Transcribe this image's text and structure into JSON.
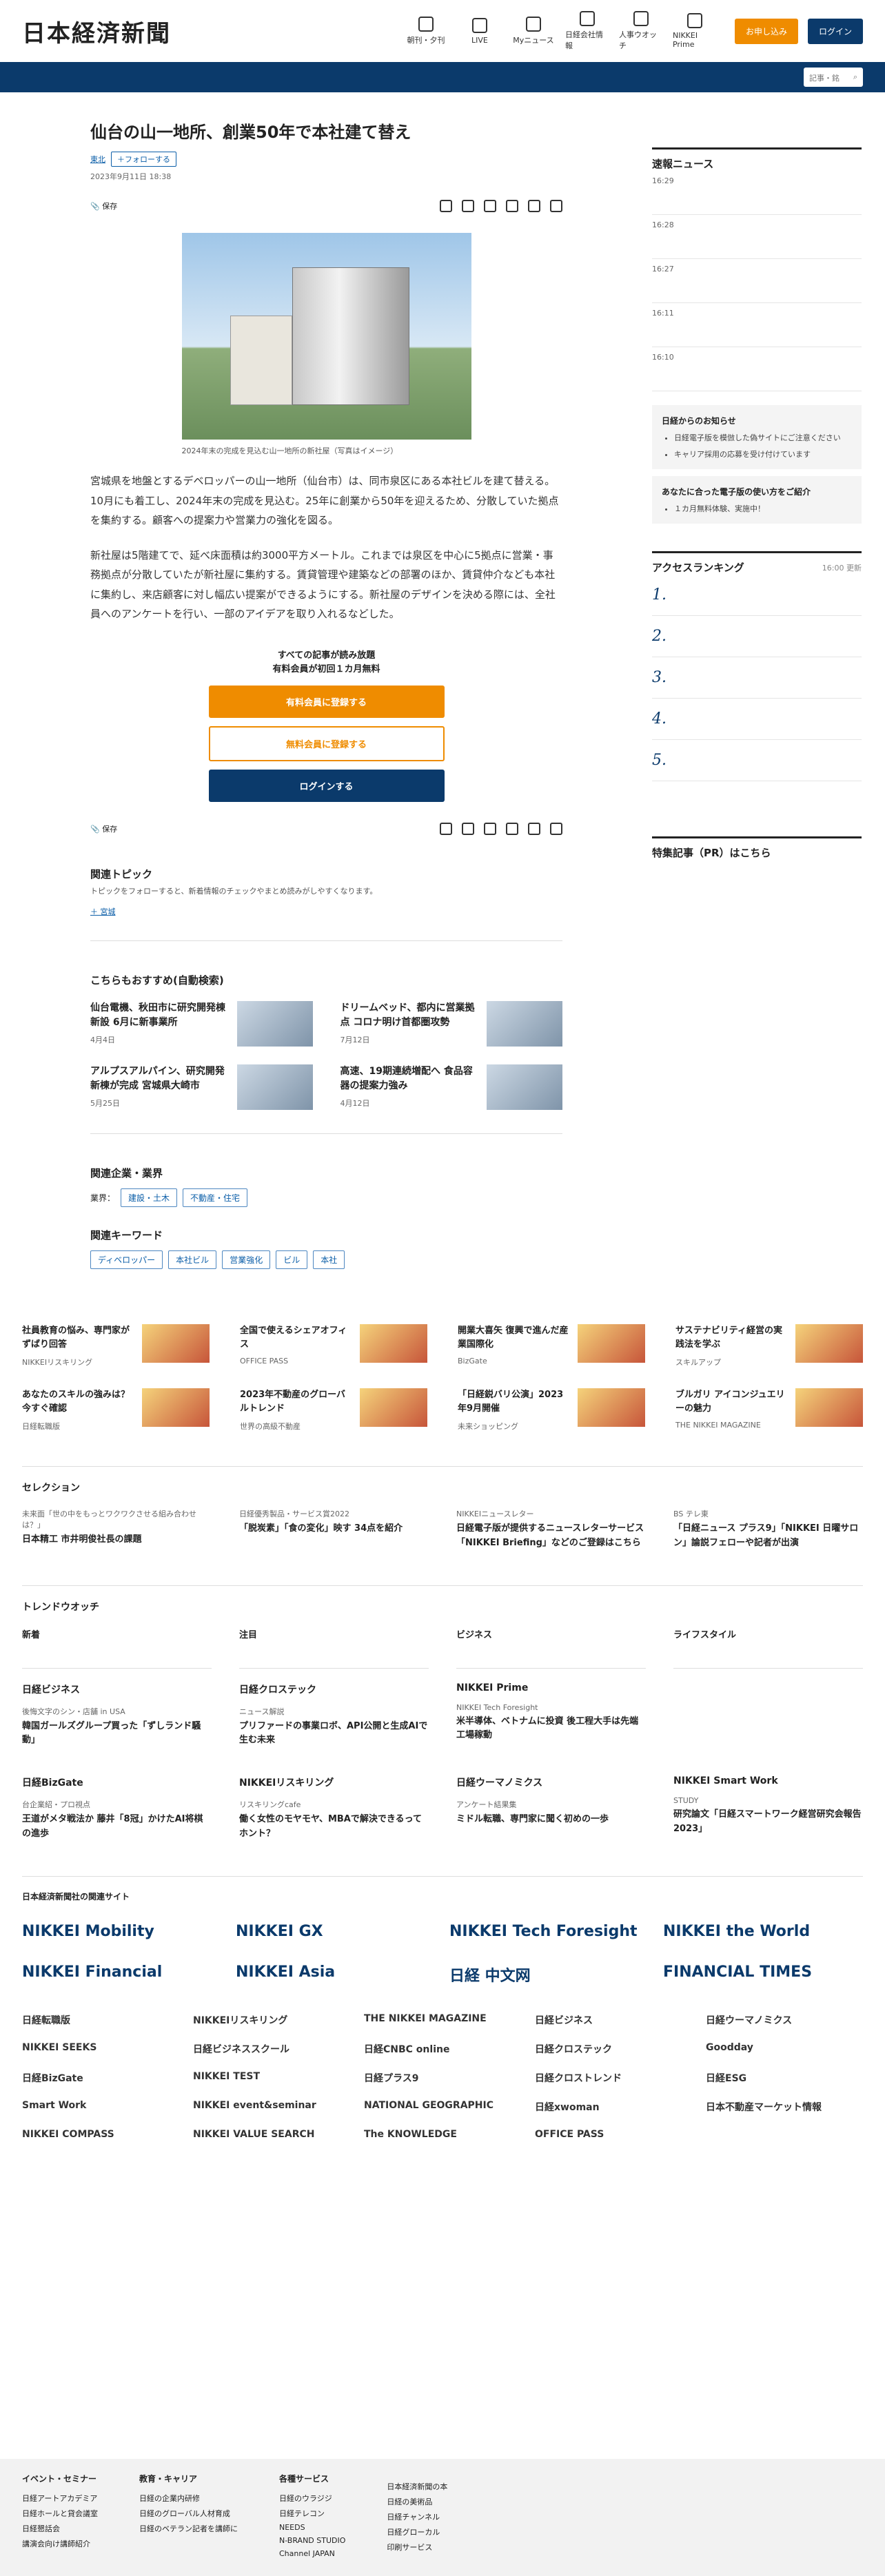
{
  "header": {
    "logo": "日本経済新聞",
    "nav": [
      "朝刊・夕刊",
      "LIVE",
      "Myニュース",
      "日経会社情報",
      "人事ウオッチ",
      "NIKKEI Prime"
    ],
    "signup": "お申し込み",
    "login": "ログイン",
    "search": "記事・銘"
  },
  "article": {
    "title": "仙台の山一地所、創業50年で本社建て替え",
    "region": "東北",
    "follow": "＋フォローする",
    "date": "2023年9月11日 18:38",
    "save": "保存",
    "caption": "2024年末の完成を見込む山一地所の新社屋（写真はイメージ）",
    "p1": "宮城県を地盤とするデベロッパーの山一地所（仙台市）は、同市泉区にある本社ビルを建て替える。10月にも着工し、2024年末の完成を見込む。25年に創業から50年を迎えるため、分散していた拠点を集約する。顧客への提案力や営業力の強化を図る。",
    "p2": "新社屋は5階建てで、延べ床面積は約3000平方メートル。これまでは泉区を中心に5拠点に営業・事務拠点が分散していたが新社屋に集約する。賃貸管理や建築などの部署のほか、賃貸仲介なども本社に集約し、来店顧客に対し幅広い提案ができるようにする。新社屋のデザインを決める際には、全社員へのアンケートを行い、一部のアイデアを取り入れるなどした。"
  },
  "paywall": {
    "line1": "すべての記事が読み放題",
    "line2": "有料会員が初回１カ月無料",
    "b1": "有料会員に登録する",
    "b2": "無料会員に登録する",
    "b3": "ログインする"
  },
  "topic": {
    "title": "関連トピック",
    "sub": "トピックをフォローすると、新着情報のチェックやまとめ読みがしやすくなります。",
    "item": "宮城"
  },
  "rec": {
    "title": "こちらもおすすめ(自動検索)",
    "items": [
      {
        "t": "仙台電機、秋田市に研究開発棟新設 6月に新事業所",
        "d": "4月4日"
      },
      {
        "t": "ドリームベッド、都内に営業拠点 コロナ明け首都圏攻勢",
        "d": "7月12日"
      },
      {
        "t": "アルプスアルパイン、研究開発新棟が完成 宮城県大崎市",
        "d": "5月25日"
      },
      {
        "t": "高速、19期連続増配へ 食品容器の提案力強み",
        "d": "4月12日"
      }
    ]
  },
  "company": {
    "title": "関連企業・業界",
    "label": "業界：",
    "items": [
      "建設・土木",
      "不動産・住宅"
    ]
  },
  "keywords": {
    "title": "関連キーワード",
    "items": [
      "ディベロッパー",
      "本社ビル",
      "営業強化",
      "ビル",
      "本社"
    ]
  },
  "side": {
    "news": "速報ニュース",
    "times": [
      "16:29",
      "16:28",
      "16:27",
      "16:11",
      "16:10"
    ],
    "notice": "日経からのお知らせ",
    "notice_items": [
      "日経電子版を模倣した偽サイトにご注意ください",
      "キャリア採用の応募を受け付けています"
    ],
    "book": "あなたに合った電子版の使い方をご紹介",
    "book_items": [
      "１カ月無料体験、実施中！"
    ],
    "rank": "アクセスランキング",
    "rank_time": "16:00 更新",
    "pr": "特集記事（PR）はこちら"
  },
  "ads": [
    {
      "t": "社員教育の悩み、専門家がずばり回答",
      "s": "NIKKEIリスキリング"
    },
    {
      "t": "全国で使えるシェアオフィス",
      "s": "OFFICE PASS"
    },
    {
      "t": "開業大喜矢 復興で進んだ産業国際化",
      "s": "BizGate"
    },
    {
      "t": "サステナビリティ経営の実践法を学ぶ",
      "s": "スキルアップ"
    },
    {
      "t": "あなたのスキルの強みは？今すぐ確認",
      "s": "日経転職版"
    },
    {
      "t": "2023年不動産のグローバルトレンド",
      "s": "世界の高級不動産"
    },
    {
      "t": "「日経鋭バリ公演」2023年9月開催",
      "s": "未来ショッピング"
    },
    {
      "t": "ブルガリ アイコンジュエリーの魅力",
      "s": "THE NIKKEI MAGAZINE"
    }
  ],
  "selection": {
    "title": "セレクション",
    "items": [
      {
        "m": "未来面「世の中をもっとワクワクさせる組み合わせは？」",
        "t": "日本精工 市井明俊社長の課題"
      },
      {
        "m": "日経優秀製品・サービス賞2022",
        "t": "「脱炭素」「食の変化」映す 34点を紹介"
      },
      {
        "m": "NIKKEIニュースレター",
        "t": "日経電子版が提供するニュースレターサービス「NIKKEI Briefing」などのご登録はこちら"
      },
      {
        "m": "BS テレ東",
        "t": "「日経ニュース プラス9」「NIKKEI 日曜サロン」論説フェローや記者が出演"
      }
    ]
  },
  "trend": {
    "title": "トレンドウオッチ",
    "cols": [
      "新着",
      "注目",
      "ビジネス",
      "ライフスタイル"
    ]
  },
  "media": [
    {
      "h": "日経ビジネス",
      "m": "後悔文字のシン・店舗 in USA",
      "t": "韓国ガールズグループ買った「ずしランド騒動」"
    },
    {
      "h": "日経クロステック",
      "m": "ニュース解説",
      "t": "プリファードの事業ロボ、API公開と生成AIで生む未来"
    },
    {
      "h": "NIKKEI Prime",
      "m": "NIKKEI Tech Foresight",
      "t": "米半導体、ベトナムに投資 後工程大手は先端工場稼動"
    },
    {
      "h": "日経BizGate",
      "m": "台企業紹・プロ視点",
      "t": "王道がメタ戦法か 藤井「8冠」かけたAI将棋の進歩"
    },
    {
      "h": "NIKKEIリスキリング",
      "m": "リスキリングcafe",
      "t": "働く女性のモヤモヤ、MBAで解決できるってホント？"
    },
    {
      "h": "日経ウーマノミクス",
      "m": "アンケート結果集",
      "t": "ミドル転職、専門家に聞く初めの一歩"
    },
    {
      "h": "NIKKEI Smart Work",
      "m": "STUDY",
      "t": "研究論文「日経スマートワーク経営研究会報告2023」"
    }
  ],
  "related": {
    "title": "日本経済新聞社の関連サイト",
    "logos": [
      "NIKKEI Mobility",
      "NIKKEI GX",
      "NIKKEI Tech Foresight",
      "NIKKEI the World",
      "NIKKEI Financial",
      "NIKKEI Asia",
      "日経 中文网",
      "FINANCIAL TIMES"
    ],
    "small": [
      "日経転職版",
      "NIKKEIリスキリング",
      "THE NIKKEI MAGAZINE",
      "日経ビジネス",
      "日経ウーマノミクス",
      "NIKKEI SEEKS",
      "日経ビジネススクール",
      "日経CNBC online",
      "日経クロステック",
      "Goodday",
      "日経BizGate",
      "NIKKEI TEST",
      "日経プラス9",
      "日経クロストレンド",
      "日経ESG",
      "Smart Work",
      "NIKKEI event&seminar",
      "NATIONAL GEOGRAPHIC",
      "日経xwoman",
      "日本不動産マーケット情報",
      "NIKKEI COMPASS",
      "NIKKEI VALUE SEARCH",
      "The KNOWLEDGE",
      "OFFICE PASS",
      ""
    ]
  },
  "footer": [
    {
      "h": "イベント・セミナー",
      "items": [
        "日経アートアカデミア",
        "日経ホールと貸会議室",
        "日経懇話会",
        "講演会向け講師紹介"
      ]
    },
    {
      "h": "教育・キャリア",
      "items": [
        "日経の企業内研修",
        "日経のグローバル人材育成",
        "日経のベテラン記者を講師に"
      ]
    },
    {
      "h": "各種サービス",
      "items": [
        "日経のウラジジ",
        "日経テレコン",
        "NEEDS",
        "N-BRAND STUDIO",
        "Channel JAPAN"
      ]
    },
    {
      "h": "",
      "items": [
        "日本経済新聞の本",
        "日経の美術品",
        "日経チャンネル",
        "日経グローカル",
        "印刷サービス"
      ]
    }
  ]
}
